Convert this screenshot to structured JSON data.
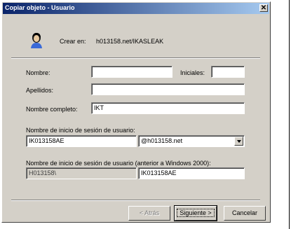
{
  "window": {
    "title": "Copiar objeto - Usuario",
    "close_symbol": "✕"
  },
  "header": {
    "icon": "user-icon",
    "create_in_label": "Crear en:",
    "create_in_value": "h013158.net/IKASLEAK"
  },
  "form": {
    "first_name": {
      "label": "Nombre:",
      "value": ""
    },
    "initials": {
      "label": "Iniciales:",
      "value": ""
    },
    "last_name": {
      "label": "Apellidos:",
      "value": ""
    },
    "full_name": {
      "label": "Nombre completo:",
      "value": "IKT"
    },
    "logon_name": {
      "label": "Nombre de inicio de sesión de usuario:",
      "value": "IK013158AE",
      "domain_selected": "@h013158.net"
    },
    "pre2000_logon": {
      "label": "Nombre de inicio de sesión de usuario (anterior a Windows 2000):",
      "domain": "H013158\\",
      "value": "IK013158AE"
    }
  },
  "buttons": {
    "back": "< Atrás",
    "next": "Siguiente >",
    "cancel": "Cancelar"
  }
}
